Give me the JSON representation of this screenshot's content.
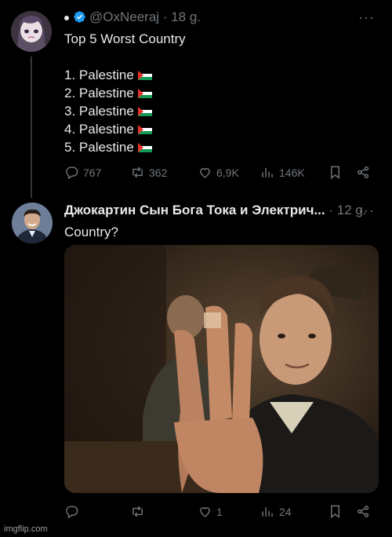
{
  "post1": {
    "status_dot": "•",
    "handle": "@OxNeeraj",
    "time": "· 18 g.",
    "more": "···",
    "title": "Top 5 Worst Country",
    "items": [
      "1.  Palestine",
      "2. Palestine",
      "3. Palestine",
      "4. Palestine",
      "5. Palestine"
    ],
    "replies": "767",
    "reposts": "362",
    "likes": "6,9K",
    "views": "146K"
  },
  "post2": {
    "name": "Джокартин Сын Бога Тока и Электрич...",
    "time": "· 12 g.",
    "more": "···",
    "text": "Country?",
    "replies": "",
    "reposts": "",
    "likes": "1",
    "views": "24"
  },
  "icons": {
    "reply": "reply-icon",
    "repost": "repost-icon",
    "like": "like-icon",
    "views": "views-icon",
    "bookmark": "bookmark-icon",
    "share": "share-icon",
    "verified": "verified-badge-icon",
    "flag": "palestine-flag-icon"
  },
  "colors": {
    "background": "#000000",
    "text": "#e7e9ea",
    "muted": "#71767b",
    "verified": "#1d9bf0"
  },
  "watermark": "imgflip.com"
}
